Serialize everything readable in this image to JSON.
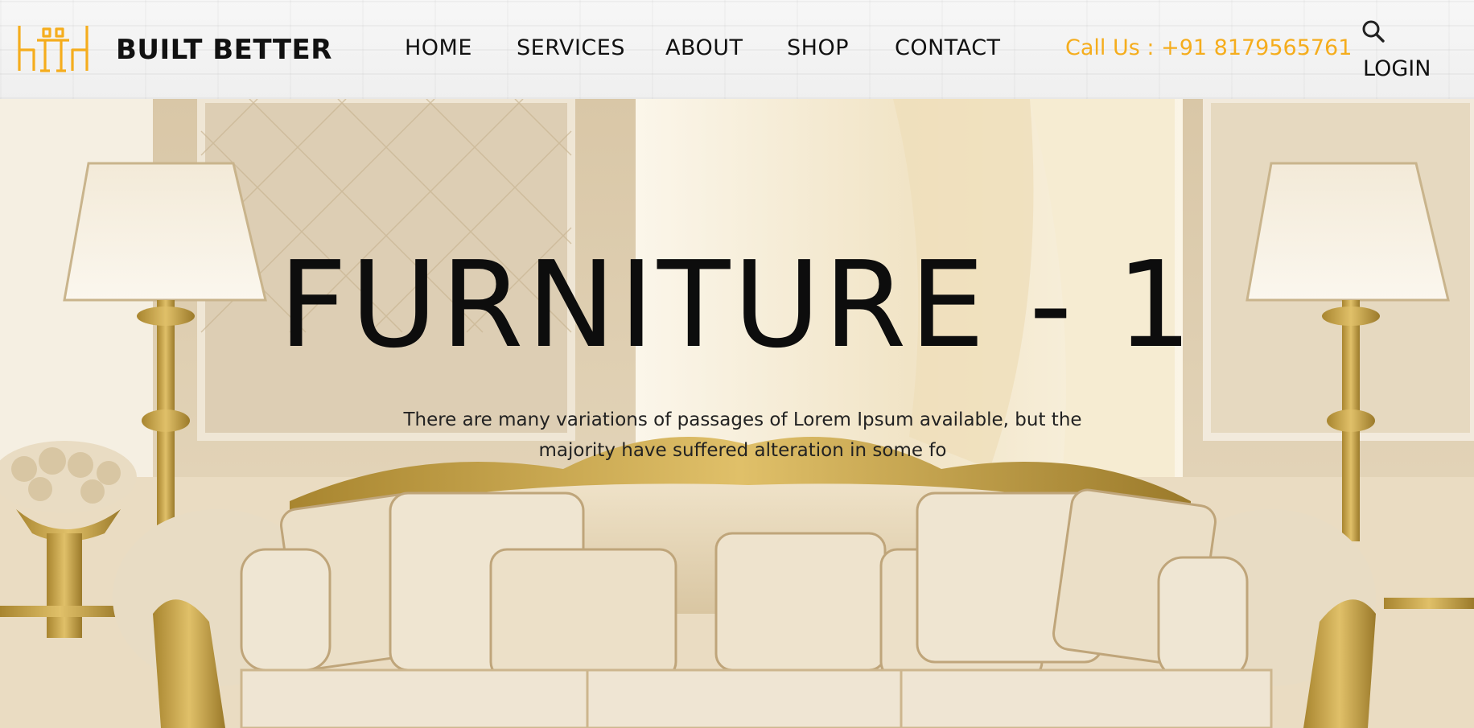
{
  "brand": {
    "name": "BUILT BETTER",
    "accent_color": "#f5ad1d",
    "logo_icon": "table-chairs-icon"
  },
  "nav": {
    "items": [
      {
        "label": "HOME"
      },
      {
        "label": "SERVICES"
      },
      {
        "label": "ABOUT"
      },
      {
        "label": "SHOP"
      },
      {
        "label": "CONTACT"
      }
    ]
  },
  "header": {
    "call_us": "Call Us : +91 8179565761",
    "search_icon": "search-icon",
    "login_label": "LOGIN"
  },
  "hero": {
    "title": "FURNITURE - 1",
    "description": "There are many variations of passages of Lorem Ipsum available, but the majority have suffered alteration in some fo"
  }
}
